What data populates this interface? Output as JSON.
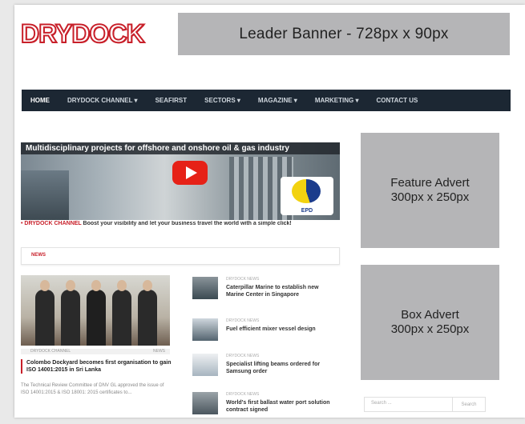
{
  "logo": {
    "text": "DRYDOCK"
  },
  "banner": {
    "label": "Leader Banner - 728px x 90px"
  },
  "nav": {
    "items": [
      "HOME",
      "DRYDOCK CHANNEL ▾",
      "SEAFIRST",
      "SECTORS ▾",
      "MAGAZINE ▾",
      "MARKETING ▾",
      "CONTACT US"
    ]
  },
  "video": {
    "title": "Multidisciplinary projects for offshore and onshore oil & gas industry",
    "brand": "EPD",
    "caption_prefix": "• DRYDOCK CHANNEL",
    "caption_text": "Boost your visibility and let your business travel the world with a simple click!"
  },
  "news": {
    "section_label": "NEWS",
    "main": {
      "meta_left": "DRYDOCK CHANNEL",
      "meta_right": "NEWS",
      "headline": "Colombo Dockyard becomes first organisation to gain ISO 14001:2015 in Sri Lanka",
      "excerpt": "The Technical Review Committee of DNV GL approved the issue of ISO 14001:2015 & ISO 18001: 2015 certificates to..."
    },
    "side": [
      {
        "date": "DRYDOCK NEWS",
        "title": "Caterpillar Marine to establish new Marine Center in Singapore"
      },
      {
        "date": "DRYDOCK NEWS",
        "title": "Fuel efficient mixer vessel design"
      },
      {
        "date": "DRYDOCK NEWS",
        "title": "Specialist lifting beams ordered for Samsung order"
      },
      {
        "date": "DRYDOCK NEWS",
        "title": "World's first ballast water port solution contract signed"
      }
    ]
  },
  "ads": {
    "feature": {
      "line1": "Feature Advert",
      "line2": "300px x 250px"
    },
    "box": {
      "line1": "Box Advert",
      "line2": "300px x 250px"
    }
  },
  "search": {
    "placeholder": "Search ...",
    "button": "Search"
  }
}
